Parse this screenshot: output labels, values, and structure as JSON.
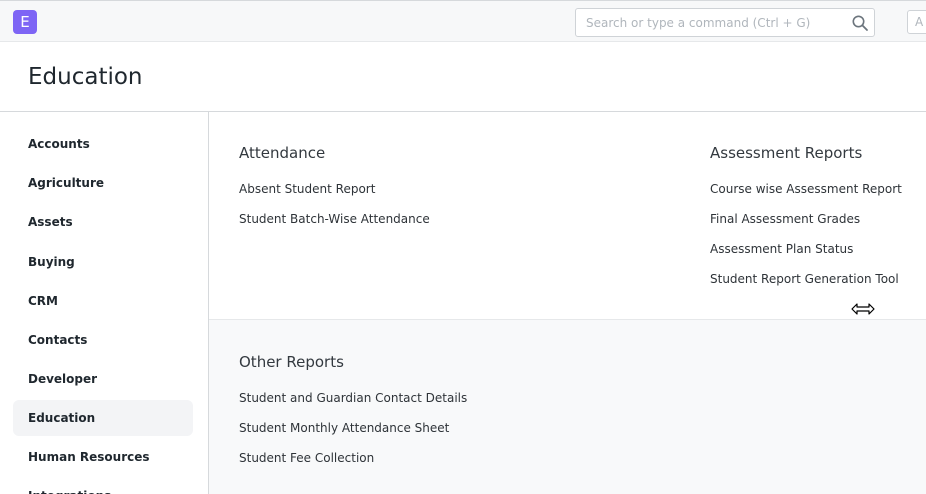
{
  "navbar": {
    "logo_letter": "E",
    "search_placeholder": "Search or type a command (Ctrl + G)",
    "avatar_letter": "A"
  },
  "page": {
    "title": "Education"
  },
  "sidebar": {
    "items": [
      {
        "label": "Accounts"
      },
      {
        "label": "Agriculture"
      },
      {
        "label": "Assets"
      },
      {
        "label": "Buying"
      },
      {
        "label": "CRM"
      },
      {
        "label": "Contacts"
      },
      {
        "label": "Developer"
      },
      {
        "label": "Education",
        "active": true
      },
      {
        "label": "Human Resources"
      },
      {
        "label": "Integrations"
      }
    ]
  },
  "main": {
    "attendance": {
      "title": "Attendance",
      "links": [
        "Absent Student Report",
        "Student Batch-Wise Attendance"
      ]
    },
    "assessment_reports": {
      "title": "Assessment Reports",
      "links": [
        "Course wise Assessment Report",
        "Final Assessment Grades",
        "Assessment Plan Status",
        "Student Report Generation Tool"
      ]
    },
    "other_reports": {
      "title": "Other Reports",
      "links": [
        "Student and Guardian Contact Details",
        "Student Monthly Attendance Sheet",
        "Student Fee Collection"
      ]
    }
  },
  "colors": {
    "brand": "#7e65f5",
    "sidebar_active": "#f3f4f6",
    "text": "#1f272e"
  }
}
